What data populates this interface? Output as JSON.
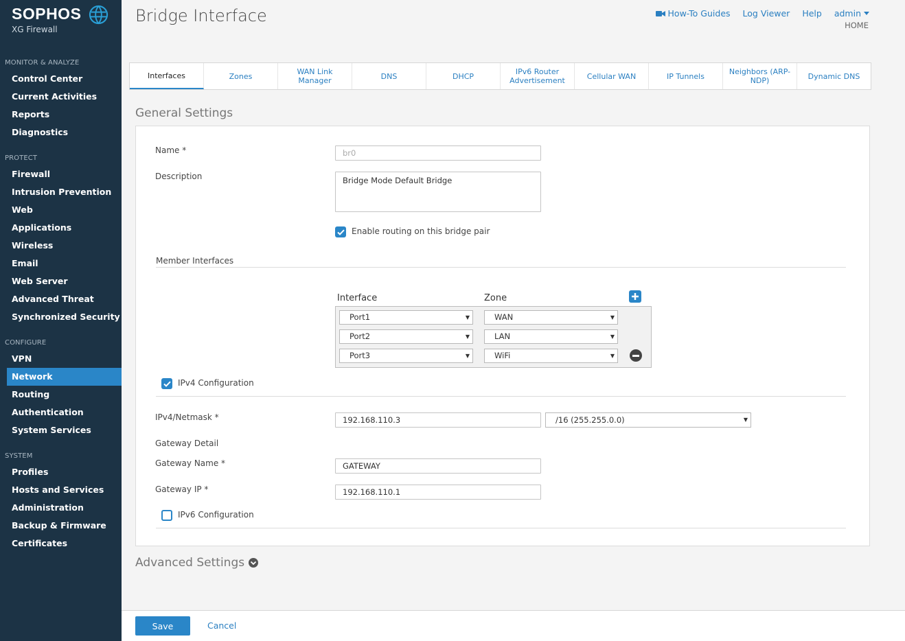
{
  "brand": {
    "name": "SOPHOS",
    "product": "XG Firewall"
  },
  "sidebar": {
    "sections": [
      {
        "title": "MONITOR & ANALYZE",
        "items": [
          "Control Center",
          "Current Activities",
          "Reports",
          "Diagnostics"
        ]
      },
      {
        "title": "PROTECT",
        "items": [
          "Firewall",
          "Intrusion Prevention",
          "Web",
          "Applications",
          "Wireless",
          "Email",
          "Web Server",
          "Advanced Threat",
          "Synchronized Security"
        ]
      },
      {
        "title": "CONFIGURE",
        "items": [
          "VPN",
          "Network",
          "Routing",
          "Authentication",
          "System Services"
        ]
      },
      {
        "title": "SYSTEM",
        "items": [
          "Profiles",
          "Hosts and Services",
          "Administration",
          "Backup & Firmware",
          "Certificates"
        ]
      }
    ],
    "active": "Network"
  },
  "header": {
    "title": "Bridge Interface",
    "links": {
      "howto": "How-To Guides",
      "logviewer": "Log Viewer",
      "help": "Help",
      "user": "admin"
    },
    "home": "HOME"
  },
  "tabs": [
    "Interfaces",
    "Zones",
    "WAN Link Manager",
    "DNS",
    "DHCP",
    "IPv6 Router Advertisement",
    "Cellular WAN",
    "IP Tunnels",
    "Neighbors (ARP-NDP)",
    "Dynamic DNS"
  ],
  "active_tab": "Interfaces",
  "general": {
    "title": "General Settings",
    "name_label": "Name *",
    "name_value": "br0",
    "description_label": "Description",
    "description_value": "Bridge Mode Default Bridge",
    "routing_label": "Enable routing on this bridge pair",
    "routing_checked": true,
    "member_title": "Member Interfaces",
    "col_interface": "Interface",
    "col_zone": "Zone",
    "members": [
      {
        "interface": "Port1",
        "zone": "WAN"
      },
      {
        "interface": "Port2",
        "zone": "LAN"
      },
      {
        "interface": "Port3",
        "zone": "WiFi"
      }
    ],
    "ipv4_label": "IPv4 Configuration",
    "ipv4_checked": true,
    "ipv4_netmask_label": "IPv4/Netmask *",
    "ipv4_value": "192.168.110.3",
    "netmask_value": "/16 (255.255.0.0)",
    "gateway_detail_label": "Gateway Detail",
    "gateway_name_label": "Gateway Name  *",
    "gateway_name_value": "GATEWAY",
    "gateway_ip_label": "Gateway IP  *",
    "gateway_ip_value": "192.168.110.1",
    "ipv6_label": "IPv6 Configuration",
    "ipv6_checked": false
  },
  "advanced": {
    "title": "Advanced Settings"
  },
  "footer": {
    "save": "Save",
    "cancel": "Cancel"
  },
  "colors": {
    "sidebar_bg": "#1c3345",
    "accent": "#2a86c8",
    "link": "#2a7fc1"
  }
}
